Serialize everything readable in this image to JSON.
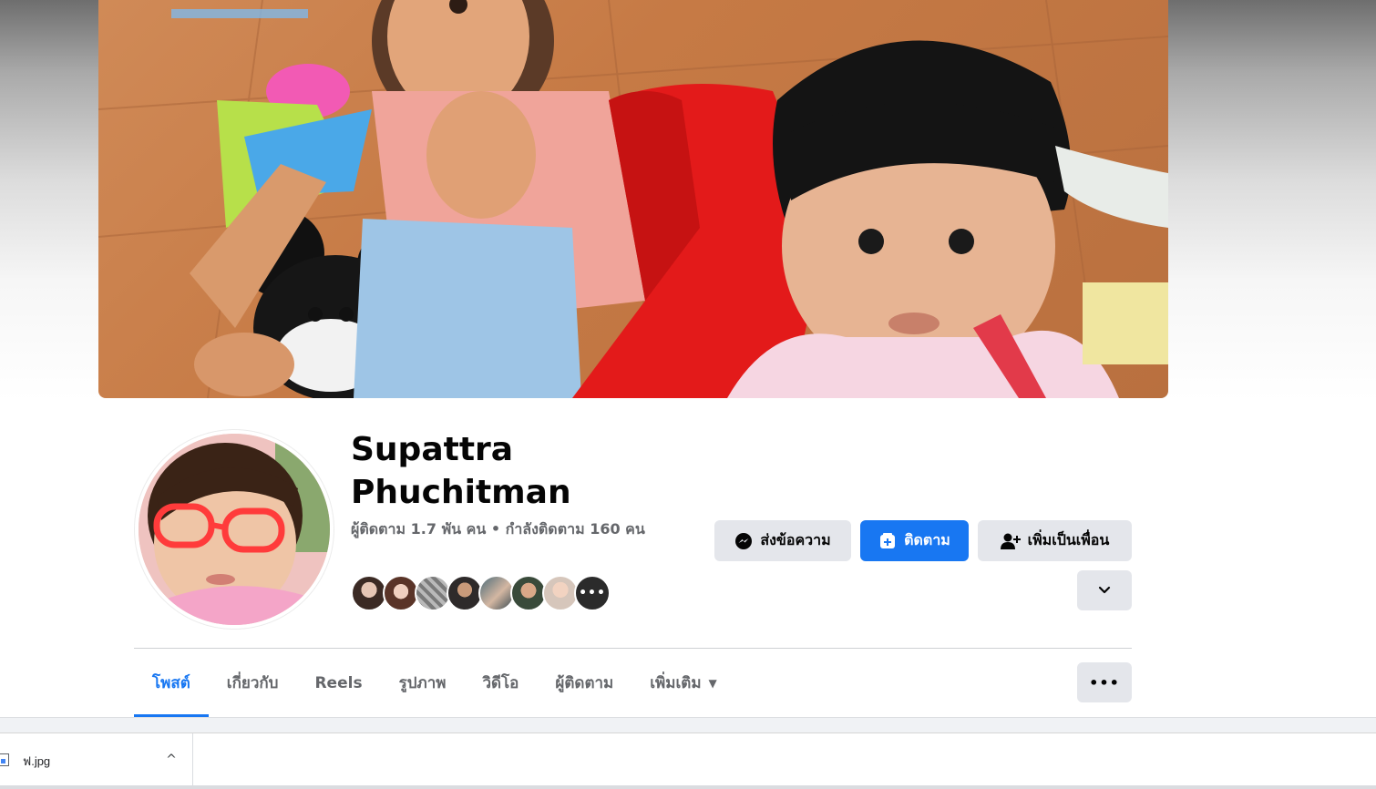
{
  "profile": {
    "name": "Supattra Phuchitman",
    "stats": "ผู้ติดตาม 1.7 พัน คน • กำลังติดตาม 160 คน",
    "friends_more": "•••"
  },
  "actions": {
    "message_label": "ส่งข้อความ",
    "follow_label": "ติดตาม",
    "add_friend_label": "เพิ่มเป็นเพื่อน",
    "more_options": "•••"
  },
  "tabs": [
    {
      "label": "โพสต์",
      "active": true
    },
    {
      "label": "เกี่ยวกับ"
    },
    {
      "label": "Reels"
    },
    {
      "label": "รูปภาพ"
    },
    {
      "label": "วิดีโอ"
    },
    {
      "label": "ผู้ติดตาม"
    },
    {
      "label": "เพิ่มเติม"
    }
  ],
  "download_bar": {
    "file_name": "ฟ.jpg",
    "toggle": "^"
  },
  "colors": {
    "accent": "#1877f2",
    "secondary_button": "#e4e6eb",
    "muted_text": "#65676b"
  }
}
